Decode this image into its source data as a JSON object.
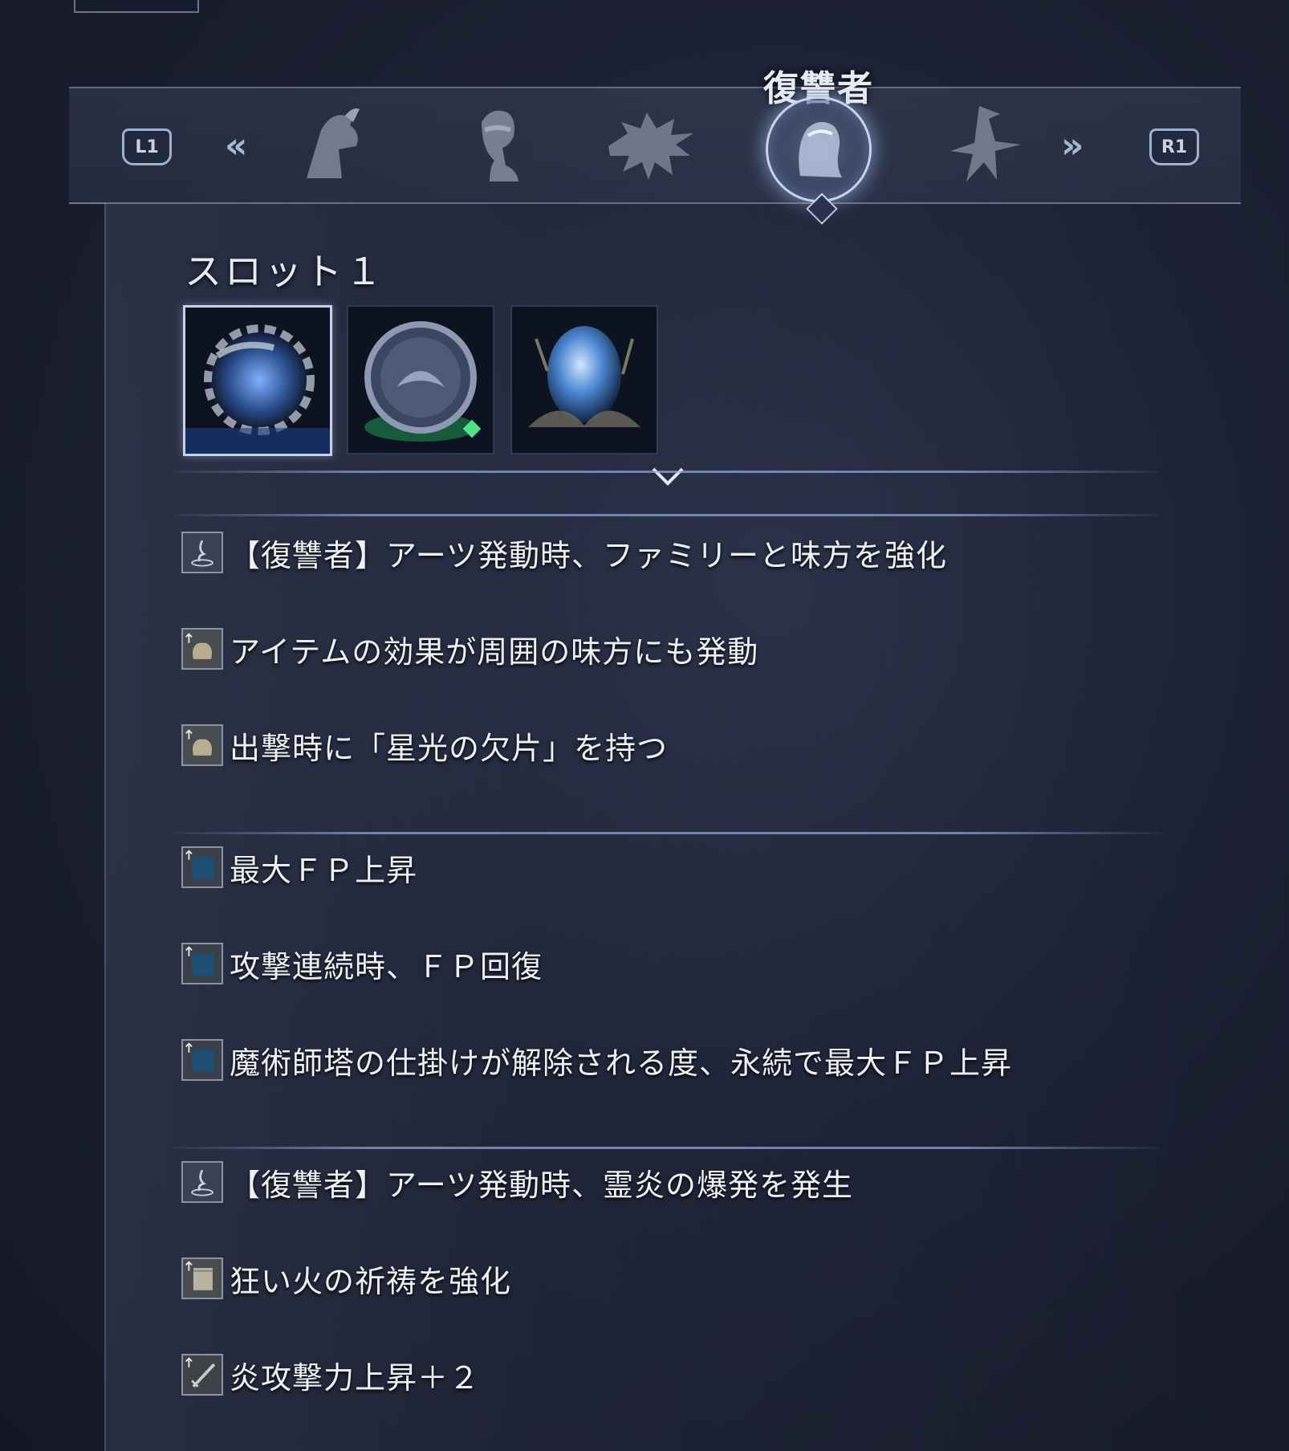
{
  "header": {
    "active_tab_title": "復讐者",
    "left_button": "L1",
    "right_button": "R1",
    "left_chevron": "«",
    "right_chevron": "»",
    "tabs": [
      {
        "icon": "hooded-figure-icon"
      },
      {
        "icon": "profile-head-icon"
      },
      {
        "icon": "spiked-beast-icon"
      },
      {
        "icon": "veiled-woman-icon",
        "active": true
      },
      {
        "icon": "witch-hat-icon"
      }
    ]
  },
  "slot": {
    "title": "スロット１",
    "relics": [
      {
        "icon": "thorned-orb-relic-icon",
        "selected": true
      },
      {
        "icon": "engraved-medallion-relic-icon",
        "selected": false
      },
      {
        "icon": "blue-egg-relic-icon",
        "selected": false
      }
    ]
  },
  "effect_groups": [
    {
      "effects": [
        {
          "icon": "arts-flame-icon",
          "text": "【復讐者】アーツ発動時、ファミリーと味方を強化"
        },
        {
          "icon": "item-pouch-icon",
          "text": "アイテムの効果が周囲の味方にも発動"
        },
        {
          "icon": "item-pouch-icon",
          "text": "出撃時に「星光の欠片」を持つ"
        }
      ]
    },
    {
      "effects": [
        {
          "icon": "fp-up-icon",
          "text": "最大ＦＰ上昇"
        },
        {
          "icon": "fp-up-icon",
          "text": "攻撃連続時、ＦＰ回復"
        },
        {
          "icon": "fp-up-icon",
          "text": "魔術師塔の仕掛けが解除される度、永続で最大ＦＰ上昇"
        }
      ]
    },
    {
      "effects": [
        {
          "icon": "arts-flame-icon",
          "text": "【復讐者】アーツ発動時、霊炎の爆発を発生"
        },
        {
          "icon": "scroll-up-icon",
          "text": "狂い火の祈祷を強化"
        },
        {
          "icon": "sword-up-icon",
          "text": "炎攻撃力上昇＋２"
        }
      ]
    }
  ]
}
